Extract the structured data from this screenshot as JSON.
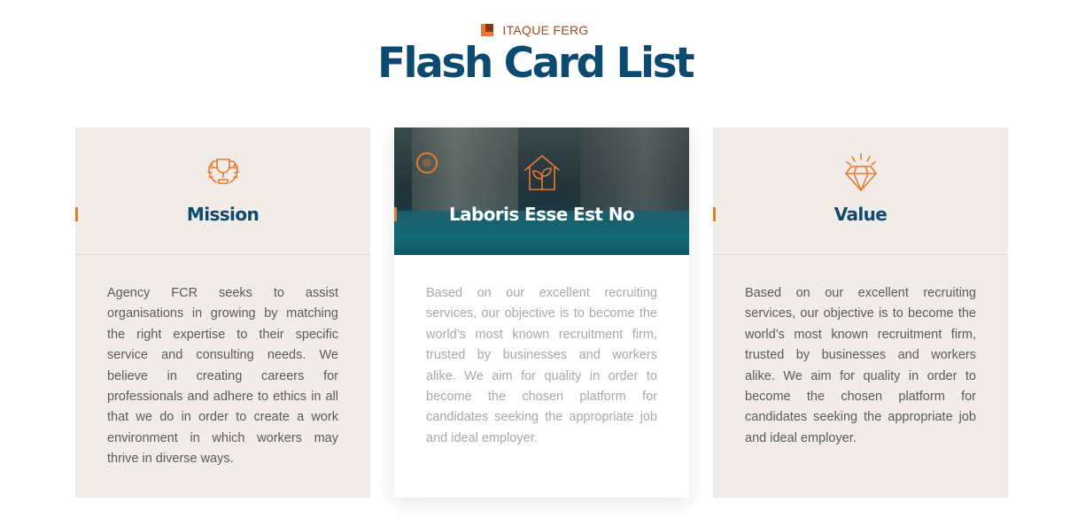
{
  "header": {
    "eyebrow": "ITAQUE FERG",
    "title": "Flash Card List"
  },
  "colors": {
    "accent": "#e97a2e",
    "title": "#0d4a6f",
    "card_bg": "#f1ece7"
  },
  "cards": [
    {
      "icon": "trophy-icon",
      "title": "Mission",
      "body": "Agency FCR seeks to assist organisations in growing by matching the right expertise to their specific service and consulting needs. We believe in creating careers for professionals and adhere to ethics in all that we do in order to create a work environment in which workers may thrive in diverse ways."
    },
    {
      "icon": "house-plant-icon",
      "title": "Laboris Esse Est No",
      "body": "Based on our excellent recruiting services, our objective is to become the world’s most known recruitment firm, trusted by businesses and workers alike. We aim for quality in order to become the chosen platform for candidates seeking the appropriate job and ideal employer."
    },
    {
      "icon": "diamond-icon",
      "title": "Value",
      "body": "Based on our excellent recruiting services, our objective is to become the world’s most known recruitment firm, trusted by businesses and workers alike. We aim for quality in order to become the chosen platform for candidates seeking the appropriate job and ideal employer."
    }
  ]
}
